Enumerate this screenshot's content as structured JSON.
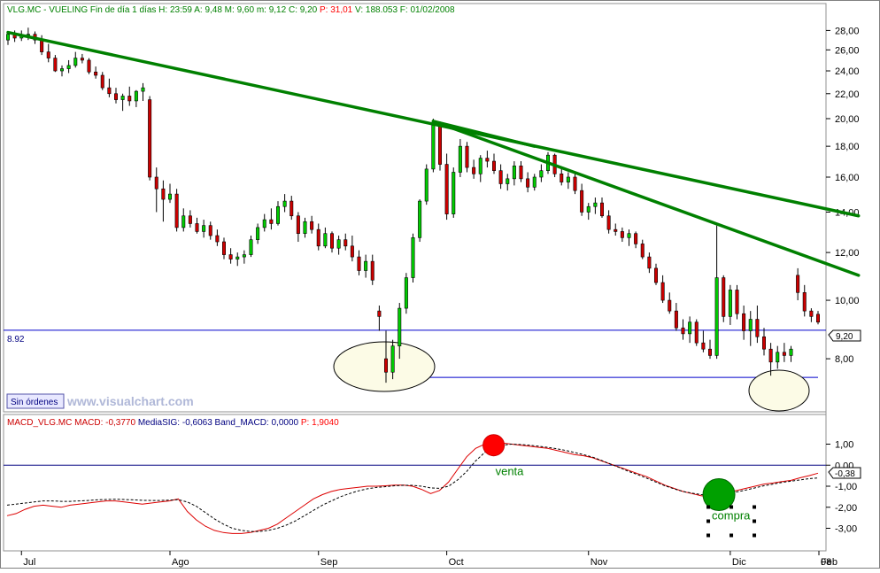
{
  "header": {
    "title_parts": [
      {
        "text": "VLG.MC - VUELING  Fin de día 1 días H: 23:59",
        "color": "#008000"
      },
      {
        "text": "A: 9,48",
        "color": "#008000"
      },
      {
        "text": "M: 9,60",
        "color": "#008000"
      },
      {
        "text": "m: 9,12",
        "color": "#008000"
      },
      {
        "text": "C: 9,20",
        "color": "#008000"
      },
      {
        "text": "P: 31,01",
        "color": "#ff0000"
      },
      {
        "text": "V: 188.053",
        "color": "#008000"
      },
      {
        "text": "F: 01/02/2008",
        "color": "#008000"
      }
    ]
  },
  "price_panel": {
    "level_label": "8.92",
    "last_price_badge": "9,20",
    "status_button": "Sin órdenes",
    "watermark": "www.visualchart.com",
    "annotations": [
      {
        "type": "ellipse",
        "note": "double bottom Oct"
      },
      {
        "type": "ellipse",
        "note": "bottom Jan"
      }
    ]
  },
  "macd_panel": {
    "header_parts": [
      {
        "text": "MACD_VLG.MC",
        "color": "#cc0000"
      },
      {
        "text": "MACD: -0,3770",
        "color": "#cc0000"
      },
      {
        "text": "MediaSIG: -0,6063",
        "color": "#000080"
      },
      {
        "text": "Band_MACD: 0,0000",
        "color": "#000080"
      },
      {
        "text": "P: 1,9040",
        "color": "#ff0000"
      }
    ],
    "last_value_badge": "-0,38",
    "signal_labels": {
      "sell": "venta",
      "buy": "compra"
    }
  },
  "colors": {
    "up": "#00cc00",
    "down": "#cc0000",
    "trendline": "#008000",
    "support": "#0000cc",
    "macd": "#dd0000",
    "signal": "#000000"
  },
  "chart_data": [
    {
      "type": "candlestick",
      "title": "VLG.MC - VUELING",
      "x_labels": [
        "Jul",
        "Ago",
        "Sep",
        "Oct",
        "Nov",
        "Dic",
        "08",
        "Feb"
      ],
      "y_ticks": [
        "8,00",
        "10,00",
        "12,00",
        "14,00",
        "16,00",
        "18,00",
        "20,00",
        "22,00",
        "24,00",
        "26,00",
        "28,00"
      ],
      "y_scale": "log",
      "ylim": [
        6.6,
        30.0
      ],
      "candles": [
        [
          27.0,
          27.9,
          26.5,
          27.6
        ],
        [
          27.6,
          28.0,
          26.8,
          27.2
        ],
        [
          27.2,
          28.0,
          26.9,
          27.5
        ],
        [
          27.5,
          28.3,
          27.0,
          27.6
        ],
        [
          27.6,
          27.9,
          26.6,
          27.0
        ],
        [
          27.0,
          27.5,
          25.5,
          25.8
        ],
        [
          25.8,
          26.6,
          24.8,
          25.2
        ],
        [
          25.2,
          25.5,
          23.9,
          24.0
        ],
        [
          24.0,
          24.5,
          23.5,
          24.2
        ],
        [
          24.2,
          25.0,
          23.8,
          24.5
        ],
        [
          24.5,
          25.8,
          24.3,
          25.2
        ],
        [
          25.2,
          25.6,
          24.7,
          25.0
        ],
        [
          25.0,
          25.2,
          23.7,
          23.9
        ],
        [
          23.9,
          24.4,
          23.3,
          23.6
        ],
        [
          23.6,
          23.9,
          22.3,
          22.5
        ],
        [
          22.5,
          23.3,
          21.7,
          22.0
        ],
        [
          22.0,
          22.5,
          21.2,
          21.5
        ],
        [
          21.5,
          22.0,
          20.6,
          21.8
        ],
        [
          21.8,
          22.6,
          21.0,
          21.4
        ],
        [
          21.4,
          22.3,
          20.9,
          22.2
        ],
        [
          22.2,
          22.9,
          21.4,
          22.5
        ],
        [
          21.5,
          21.8,
          15.8,
          16.0
        ],
        [
          16.0,
          16.6,
          14.0,
          15.3
        ],
        [
          15.3,
          15.8,
          13.5,
          14.7
        ],
        [
          14.7,
          15.6,
          14.5,
          15.0
        ],
        [
          15.0,
          15.3,
          13.0,
          13.2
        ],
        [
          13.2,
          14.2,
          13.0,
          13.8
        ],
        [
          13.8,
          14.1,
          13.2,
          13.4
        ],
        [
          13.4,
          13.7,
          12.9,
          13.0
        ],
        [
          13.0,
          13.6,
          12.7,
          13.3
        ],
        [
          13.3,
          13.5,
          12.6,
          12.8
        ],
        [
          12.8,
          13.1,
          12.3,
          12.5
        ],
        [
          12.5,
          12.7,
          11.7,
          11.9
        ],
        [
          11.9,
          12.2,
          11.5,
          11.7
        ],
        [
          11.7,
          12.0,
          11.4,
          11.8
        ],
        [
          11.8,
          12.1,
          11.5,
          11.9
        ],
        [
          11.9,
          12.8,
          11.8,
          12.6
        ],
        [
          12.6,
          13.4,
          12.4,
          13.2
        ],
        [
          13.2,
          13.9,
          13.0,
          13.6
        ],
        [
          13.6,
          14.2,
          13.1,
          13.4
        ],
        [
          13.4,
          14.6,
          13.3,
          14.3
        ],
        [
          14.3,
          15.0,
          14.0,
          14.6
        ],
        [
          14.6,
          14.9,
          13.6,
          13.8
        ],
        [
          13.8,
          14.0,
          12.5,
          12.9
        ],
        [
          12.9,
          13.7,
          12.7,
          13.5
        ],
        [
          13.5,
          13.8,
          12.9,
          13.1
        ],
        [
          13.1,
          13.4,
          12.1,
          12.3
        ],
        [
          12.3,
          13.2,
          12.2,
          12.9
        ],
        [
          12.9,
          13.0,
          12.0,
          12.2
        ],
        [
          12.2,
          12.8,
          11.9,
          12.6
        ],
        [
          12.6,
          12.9,
          12.1,
          12.3
        ],
        [
          12.3,
          12.8,
          11.6,
          11.8
        ],
        [
          11.8,
          12.1,
          11.0,
          11.2
        ],
        [
          11.2,
          11.9,
          10.9,
          11.6
        ],
        [
          11.6,
          11.9,
          10.6,
          10.8
        ],
        [
          9.6,
          9.8,
          8.9,
          9.4
        ],
        [
          8.0,
          8.9,
          7.3,
          7.6
        ],
        [
          7.6,
          8.6,
          7.4,
          8.4
        ],
        [
          8.4,
          9.9,
          8.0,
          9.7
        ],
        [
          9.7,
          11.1,
          9.5,
          10.9
        ],
        [
          10.9,
          12.9,
          10.7,
          12.7
        ],
        [
          12.7,
          14.7,
          12.5,
          14.6
        ],
        [
          14.6,
          16.8,
          14.4,
          16.5
        ],
        [
          16.5,
          20.0,
          16.3,
          19.5
        ],
        [
          19.5,
          19.8,
          16.4,
          16.8
        ],
        [
          16.8,
          17.5,
          13.6,
          13.9
        ],
        [
          13.9,
          16.6,
          13.7,
          16.3
        ],
        [
          16.3,
          18.5,
          16.0,
          18.0
        ],
        [
          18.0,
          18.3,
          16.3,
          16.6
        ],
        [
          16.6,
          17.1,
          15.9,
          16.2
        ],
        [
          16.2,
          17.4,
          15.7,
          17.2
        ],
        [
          17.2,
          17.7,
          16.6,
          17.0
        ],
        [
          17.0,
          17.5,
          16.2,
          16.4
        ],
        [
          16.4,
          16.8,
          15.3,
          15.6
        ],
        [
          15.6,
          16.2,
          15.2,
          15.9
        ],
        [
          15.9,
          17.0,
          15.5,
          16.7
        ],
        [
          16.7,
          17.0,
          15.7,
          15.9
        ],
        [
          15.9,
          16.3,
          15.1,
          15.4
        ],
        [
          15.4,
          16.2,
          15.2,
          16.0
        ],
        [
          16.0,
          16.8,
          15.7,
          16.4
        ],
        [
          16.4,
          17.6,
          16.2,
          17.4
        ],
        [
          17.4,
          17.5,
          16.0,
          16.2
        ],
        [
          16.2,
          16.6,
          15.5,
          15.7
        ],
        [
          15.7,
          16.3,
          15.3,
          16.0
        ],
        [
          16.0,
          16.3,
          15.0,
          15.2
        ],
        [
          15.2,
          15.6,
          13.8,
          14.0
        ],
        [
          14.0,
          14.5,
          13.6,
          14.3
        ],
        [
          14.3,
          14.8,
          13.9,
          14.5
        ],
        [
          14.5,
          14.8,
          13.7,
          13.8
        ],
        [
          13.8,
          14.1,
          12.9,
          13.1
        ],
        [
          13.1,
          13.4,
          12.8,
          13.0
        ],
        [
          13.0,
          13.2,
          12.5,
          12.7
        ],
        [
          12.7,
          13.1,
          12.3,
          12.9
        ],
        [
          12.9,
          13.0,
          12.2,
          12.4
        ],
        [
          12.4,
          12.6,
          11.7,
          11.8
        ],
        [
          11.8,
          12.0,
          11.1,
          11.3
        ],
        [
          11.3,
          11.5,
          10.6,
          10.7
        ],
        [
          10.7,
          11.0,
          9.9,
          10.0
        ],
        [
          10.0,
          10.3,
          9.5,
          9.6
        ],
        [
          9.6,
          9.9,
          8.9,
          9.0
        ],
        [
          9.0,
          9.3,
          8.6,
          8.8
        ],
        [
          8.8,
          9.4,
          8.5,
          9.2
        ],
        [
          9.2,
          9.3,
          8.4,
          8.5
        ],
        [
          8.5,
          8.9,
          8.2,
          8.3
        ],
        [
          8.3,
          8.6,
          8.0,
          8.1
        ],
        [
          8.1,
          13.3,
          8.0,
          10.9
        ],
        [
          10.9,
          11.0,
          9.2,
          9.4
        ],
        [
          9.4,
          10.6,
          9.1,
          10.4
        ],
        [
          10.4,
          10.6,
          9.3,
          9.5
        ],
        [
          9.5,
          9.8,
          8.6,
          8.9
        ],
        [
          8.9,
          9.6,
          8.4,
          9.3
        ],
        [
          9.3,
          9.8,
          8.5,
          8.7
        ],
        [
          8.7,
          9.0,
          8.1,
          8.3
        ],
        [
          8.3,
          8.5,
          7.5,
          7.9
        ],
        [
          7.9,
          8.4,
          7.7,
          8.2
        ],
        [
          8.2,
          8.5,
          7.9,
          8.1
        ],
        [
          8.1,
          8.4,
          7.9,
          8.3
        ],
        [
          11.0,
          11.3,
          10.0,
          10.3
        ],
        [
          10.3,
          10.6,
          9.4,
          9.6
        ],
        [
          9.6,
          9.7,
          9.2,
          9.4
        ],
        [
          9.48,
          9.6,
          9.12,
          9.2
        ]
      ],
      "trendlines": [
        {
          "from": [
            0,
            27.8
          ],
          "to": [
            126,
            13.8
          ]
        },
        {
          "from": [
            63,
            19.8
          ],
          "to": [
            126,
            11.0
          ]
        },
        {
          "from": [
            63,
            19.8
          ],
          "to": [
            78,
            18.0
          ]
        }
      ],
      "horizontal_levels": [
        8.92,
        7.45
      ]
    },
    {
      "type": "line",
      "title": "MACD_VLG.MC",
      "y_ticks": [
        "1,00",
        "0,00",
        "-1,00",
        "-2,00",
        "-3,00"
      ],
      "ylim": [
        -3.4,
        1.4
      ],
      "zero_line": 0,
      "series": [
        {
          "name": "MACD",
          "values": [
            -2.4,
            -2.3,
            -2.1,
            -1.95,
            -1.9,
            -1.95,
            -2.0,
            -1.9,
            -1.85,
            -1.8,
            -1.75,
            -1.7,
            -1.7,
            -1.75,
            -1.8,
            -1.85,
            -1.8,
            -1.75,
            -1.7,
            -1.6,
            -2.2,
            -2.6,
            -2.9,
            -3.1,
            -3.2,
            -3.25,
            -3.25,
            -3.2,
            -3.1,
            -3.0,
            -2.8,
            -2.5,
            -2.2,
            -1.9,
            -1.6,
            -1.4,
            -1.25,
            -1.15,
            -1.1,
            -1.05,
            -1.0,
            -1.0,
            -0.98,
            -0.95,
            -0.95,
            -1.0,
            -1.15,
            -1.35,
            -1.2,
            -0.8,
            -0.2,
            0.4,
            0.8,
            1.0,
            1.05,
            1.05,
            1.0,
            0.95,
            0.9,
            0.85,
            0.8,
            0.7,
            0.6,
            0.5,
            0.45,
            0.35,
            0.2,
            0.05,
            -0.1,
            -0.25,
            -0.4,
            -0.55,
            -0.75,
            -0.95,
            -1.1,
            -1.25,
            -1.35,
            -1.45,
            -1.5,
            -1.45,
            -1.3,
            -1.2,
            -1.1,
            -1.0,
            -0.9,
            -0.85,
            -0.78,
            -0.72,
            -0.6,
            -0.5,
            -0.38
          ]
        },
        {
          "name": "MediaSIG",
          "values": [
            -1.9,
            -1.85,
            -1.8,
            -1.75,
            -1.7,
            -1.7,
            -1.72,
            -1.72,
            -1.7,
            -1.68,
            -1.65,
            -1.63,
            -1.62,
            -1.63,
            -1.65,
            -1.67,
            -1.68,
            -1.68,
            -1.66,
            -1.64,
            -1.75,
            -1.95,
            -2.25,
            -2.55,
            -2.8,
            -3.0,
            -3.1,
            -3.15,
            -3.15,
            -3.1,
            -3.0,
            -2.85,
            -2.65,
            -2.4,
            -2.15,
            -1.9,
            -1.7,
            -1.5,
            -1.35,
            -1.22,
            -1.12,
            -1.06,
            -1.02,
            -0.98,
            -0.96,
            -0.96,
            -1.0,
            -1.08,
            -1.1,
            -1.0,
            -0.7,
            -0.3,
            0.2,
            0.6,
            0.85,
            0.95,
            1.0,
            0.98,
            0.95,
            0.9,
            0.85,
            0.78,
            0.7,
            0.6,
            0.5,
            0.38,
            0.22,
            0.05,
            -0.12,
            -0.3,
            -0.45,
            -0.62,
            -0.8,
            -0.98,
            -1.12,
            -1.25,
            -1.33,
            -1.4,
            -1.42,
            -1.4,
            -1.35,
            -1.27,
            -1.18,
            -1.08,
            -0.98,
            -0.9,
            -0.82,
            -0.76,
            -0.7,
            -0.64,
            -0.61
          ]
        }
      ],
      "signals": [
        {
          "label": "venta",
          "index": 54,
          "value": 0.95
        },
        {
          "label": "compra",
          "index": 79,
          "value": -1.4
        }
      ]
    }
  ]
}
